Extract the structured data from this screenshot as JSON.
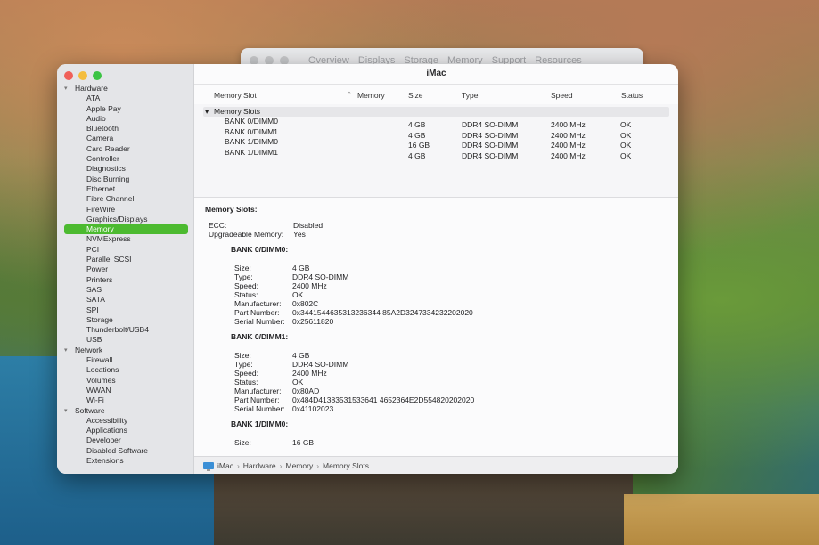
{
  "back_window": {
    "tabs": [
      "Overview",
      "Displays",
      "Storage",
      "Memory",
      "Support",
      "Resources"
    ]
  },
  "window": {
    "title": "iMac"
  },
  "sidebar": {
    "groups": [
      {
        "label": "Hardware",
        "items": [
          "ATA",
          "Apple Pay",
          "Audio",
          "Bluetooth",
          "Camera",
          "Card Reader",
          "Controller",
          "Diagnostics",
          "Disc Burning",
          "Ethernet",
          "Fibre Channel",
          "FireWire",
          "Graphics/Displays",
          "Memory",
          "NVMExpress",
          "PCI",
          "Parallel SCSI",
          "Power",
          "Printers",
          "SAS",
          "SATA",
          "SPI",
          "Storage",
          "Thunderbolt/USB4",
          "USB"
        ]
      },
      {
        "label": "Network",
        "items": [
          "Firewall",
          "Locations",
          "Volumes",
          "WWAN",
          "Wi-Fi"
        ]
      },
      {
        "label": "Software",
        "items": [
          "Accessibility",
          "Applications",
          "Developer",
          "Disabled Software",
          "Extensions"
        ]
      }
    ],
    "selected": "Memory"
  },
  "table": {
    "columns": [
      "Memory Slot",
      "Memory",
      "Size",
      "Type",
      "Speed",
      "Status"
    ],
    "group_label": "Memory Slots",
    "rows": [
      {
        "slot": "BANK 0/DIMM0",
        "size": "4 GB",
        "type": "DDR4 SO-DIMM",
        "speed": "2400 MHz",
        "status": "OK"
      },
      {
        "slot": "BANK 0/DIMM1",
        "size": "4 GB",
        "type": "DDR4 SO-DIMM",
        "speed": "2400 MHz",
        "status": "OK"
      },
      {
        "slot": "BANK 1/DIMM0",
        "size": "16 GB",
        "type": "DDR4 SO-DIMM",
        "speed": "2400 MHz",
        "status": "OK"
      },
      {
        "slot": "BANK 1/DIMM1",
        "size": "4 GB",
        "type": "DDR4 SO-DIMM",
        "speed": "2400 MHz",
        "status": "OK"
      }
    ]
  },
  "detail": {
    "heading": "Memory Slots:",
    "ecc_label": "ECC:",
    "ecc_value": "Disabled",
    "upg_label": "Upgradeable Memory:",
    "upg_value": "Yes",
    "banks": [
      {
        "name": "BANK 0/DIMM0:",
        "fields": [
          [
            "Size:",
            "4 GB"
          ],
          [
            "Type:",
            "DDR4 SO-DIMM"
          ],
          [
            "Speed:",
            "2400 MHz"
          ],
          [
            "Status:",
            "OK"
          ],
          [
            "Manufacturer:",
            "0x802C"
          ],
          [
            "Part Number:",
            "0x3441544635313236344 85A2D3247334232202020"
          ],
          [
            "Serial Number:",
            "0x25611820"
          ]
        ]
      },
      {
        "name": "BANK 0/DIMM1:",
        "fields": [
          [
            "Size:",
            "4 GB"
          ],
          [
            "Type:",
            "DDR4 SO-DIMM"
          ],
          [
            "Speed:",
            "2400 MHz"
          ],
          [
            "Status:",
            "OK"
          ],
          [
            "Manufacturer:",
            "0x80AD"
          ],
          [
            "Part Number:",
            "0x484D41383531533641 4652364E2D554820202020"
          ],
          [
            "Serial Number:",
            "0x41102023"
          ]
        ]
      },
      {
        "name": "BANK 1/DIMM0:",
        "fields": [
          [
            "Size:",
            "16 GB"
          ]
        ]
      }
    ]
  },
  "pathbar": {
    "items": [
      "iMac",
      "Hardware",
      "Memory",
      "Memory Slots"
    ]
  }
}
